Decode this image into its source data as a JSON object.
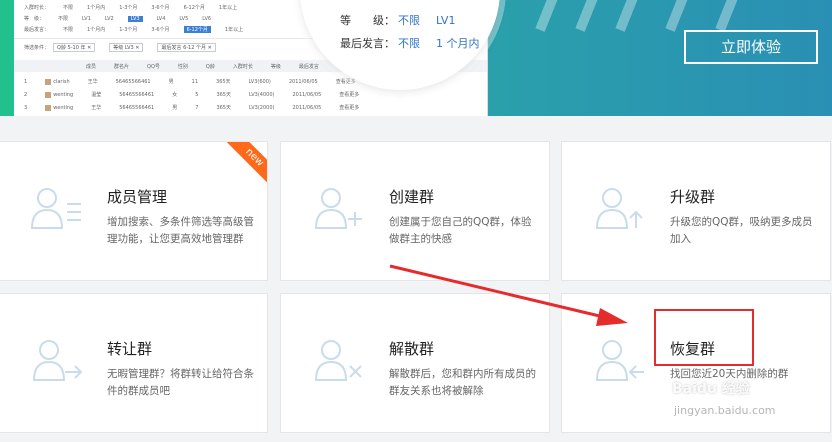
{
  "screenshot_panel": {
    "row1": [
      "入群时长：",
      "不限",
      "1个月内",
      "1-3个月",
      "3-6个月",
      "6-12个月",
      "1年以上"
    ],
    "row2": [
      "等　级：",
      "不限",
      "LV1",
      "LV2",
      "LV3",
      "LV4",
      "LV5",
      "LV6"
    ],
    "row3": [
      "最后发言：",
      "不限",
      "1个月内",
      "1-3个月",
      "3-6个月",
      "6-12个月",
      "1年以上"
    ],
    "filter_label": "筛选条件：",
    "chips": [
      "Q龄 5-10 年 ✕",
      "等级 LV3 ✕",
      "最后发言 6-12 个月 ✕"
    ],
    "table_headers": [
      "成员",
      "群名片",
      "QQ号",
      "性别",
      "Q龄",
      "入群时长",
      "等级",
      "最后发言"
    ],
    "rows": [
      [
        "1",
        "clarish",
        "王华",
        "56465566461",
        "男",
        "11",
        "365天",
        "LV3(600)",
        "2011/06/05",
        "查看更多"
      ],
      [
        "2",
        "wenting",
        "温莹",
        "56465566461",
        "女",
        "5",
        "365天",
        "LV3(4000)",
        "2011/06/05",
        "查看更多"
      ],
      [
        "3",
        "wenting",
        "王华",
        "56465566461",
        "男",
        "7",
        "365天",
        "LV3(2000)",
        "2011/06/05",
        "查看更多"
      ]
    ]
  },
  "bubble": {
    "level_label": "等　　级：",
    "level_any": "不限",
    "level_value": "LV1",
    "last_speak_label": "最后发言：",
    "last_speak_any": "不限",
    "last_speak_value": "1 个月内"
  },
  "cta_label": "立即体验",
  "cards": [
    {
      "title": "成员管理",
      "desc": "增加搜索、多条件筛选等高级管理功能，让您更高效地管理群",
      "badge": "new"
    },
    {
      "title": "创建群",
      "desc": "创建属于您自己的QQ群，体验做群主的快感"
    },
    {
      "title": "升级群",
      "desc": "升级您的QQ群，吸纳更多成员加入"
    },
    {
      "title": "转让群",
      "desc": "无暇管理群？将群转让给符合条件的群成员吧"
    },
    {
      "title": "解散群",
      "desc": "解散群后，您和群内所有成员的群友关系也将被解除"
    },
    {
      "title": "恢复群",
      "desc": "找回您近20天内删除的群"
    }
  ],
  "watermark": {
    "brand": "Baidu 经验",
    "url": "jingyan.baidu.com"
  },
  "colors": {
    "accent_blue": "#3174c9",
    "badge_orange": "#ff6a1a",
    "highlight_red": "#e52c2c",
    "banner_green": "#2bbf8e"
  }
}
